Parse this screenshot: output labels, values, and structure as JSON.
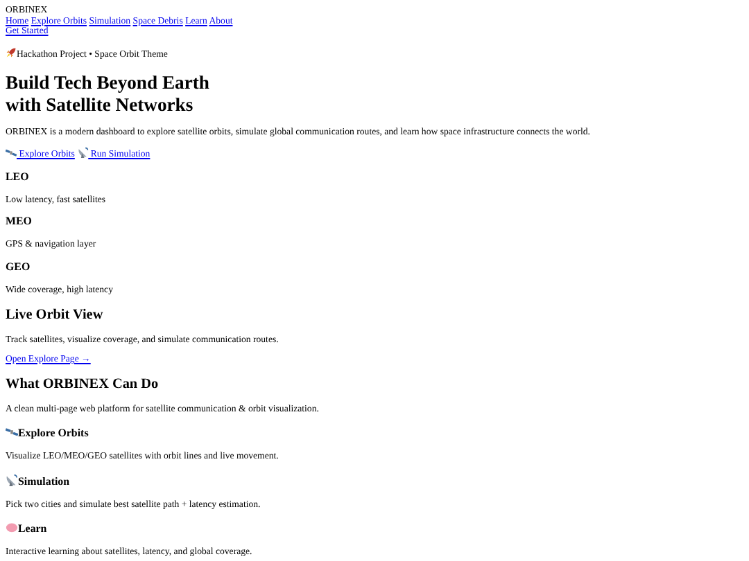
{
  "brand": "ORBINEX",
  "nav": [
    "Home",
    "Explore Orbits",
    "Simulation",
    "Space Debris",
    "Learn",
    "About"
  ],
  "cta": "Get Started",
  "badge": "Hackathon Project • Space Orbit Theme",
  "hero": {
    "title_lines": [
      "Build Tech Beyond Earth",
      "with Satellite Networks"
    ],
    "text": "ORBINEX is a modern dashboard to explore satellite orbits, simulate global communication routes, and learn how space infrastructure connects the world.",
    "links": [
      "Explore Orbits",
      "Run Simulation"
    ]
  },
  "orbits": [
    {
      "name": "LEO",
      "text": "Low latency, fast satellites"
    },
    {
      "name": "MEO",
      "text": "GPS & navigation layer"
    },
    {
      "name": "GEO",
      "text": "Wide coverage, high latency"
    }
  ],
  "live": {
    "title": "Live Orbit View",
    "text": "Track satellites, visualize coverage, and simulate communication routes.",
    "link": "Open Explore Page →"
  },
  "features": {
    "title": "What ORBINEX Can Do",
    "text": "A clean multi-page web platform for satellite communication & orbit visualization.",
    "items": [
      {
        "title": "Explore Orbits",
        "text": "Visualize LEO/MEO/GEO satellites with orbit lines and live movement."
      },
      {
        "title": "Simulation",
        "text": "Pick two cities and simulate best satellite path + latency estimation."
      },
      {
        "title": "Learn",
        "text": "Interactive learning about satellites, latency, and global coverage."
      }
    ]
  }
}
